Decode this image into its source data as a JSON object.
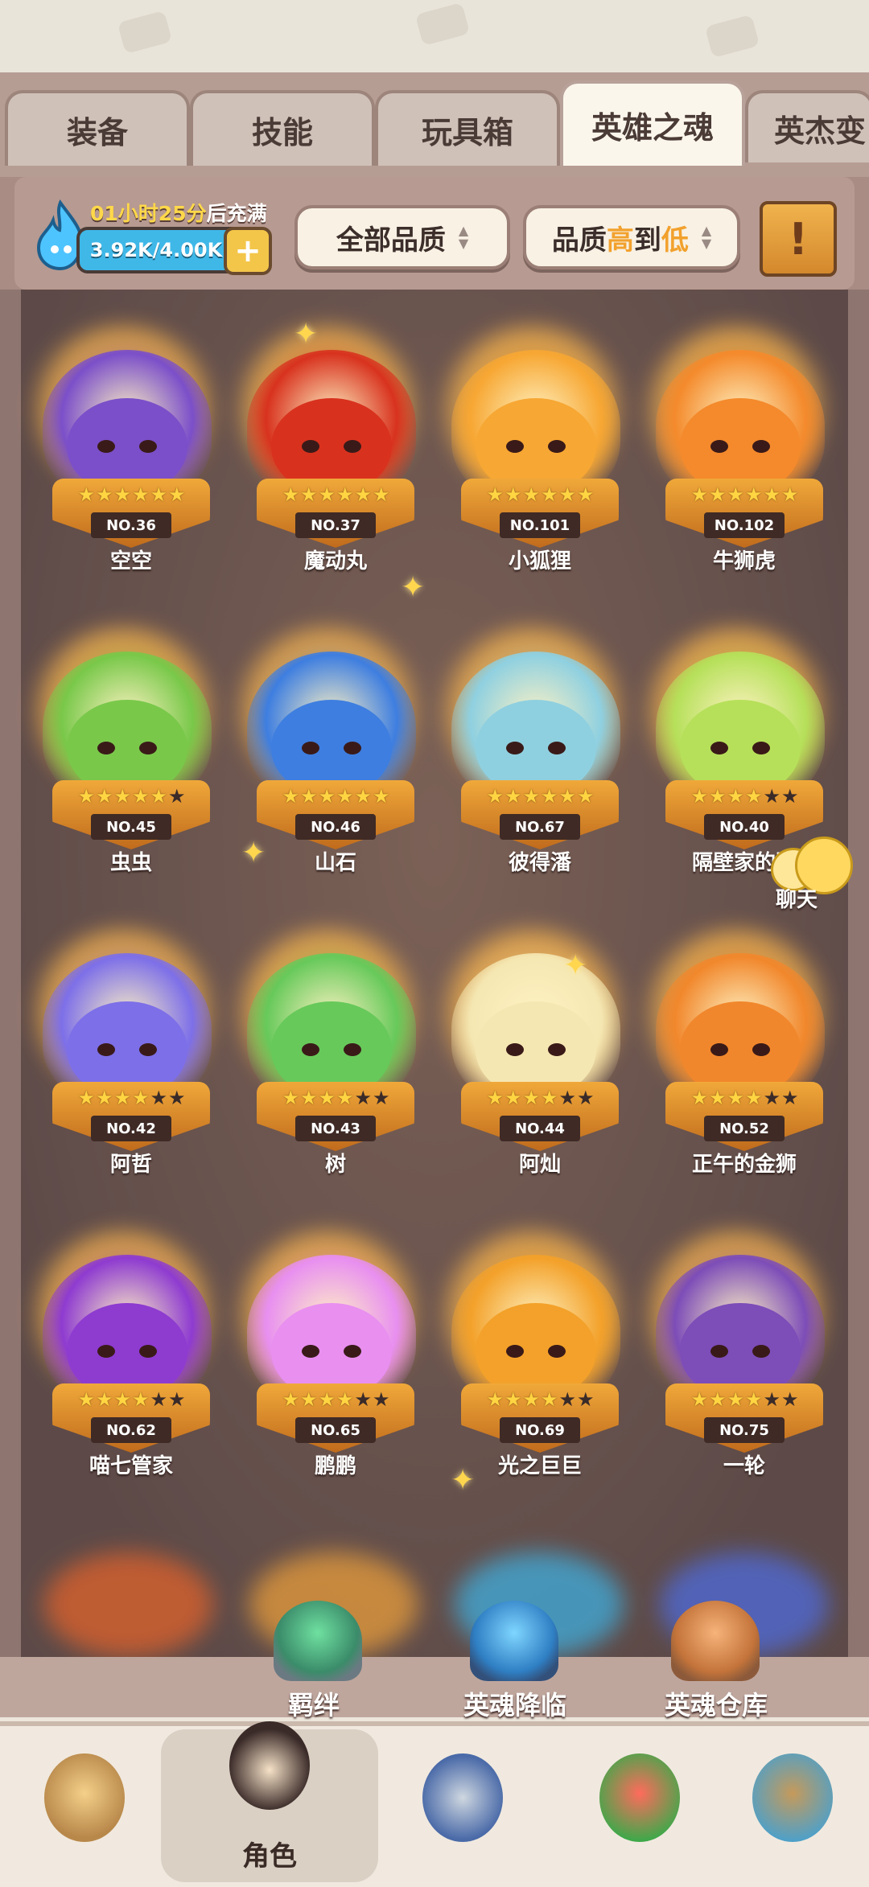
{
  "tabs": [
    "装备",
    "技能",
    "玩具箱",
    "英雄之魂",
    "英杰变"
  ],
  "active_tab": 3,
  "resource": {
    "timer_hours": "01小时",
    "timer_minutes": "25分",
    "timer_suffix": "后充满",
    "value": "3.92K/4.00K",
    "plus": "+"
  },
  "filters": {
    "quality": "全部品质",
    "sort_prefix": "品质",
    "sort_high": "高",
    "sort_mid": "到",
    "sort_low": "低"
  },
  "notice_icon": "!",
  "heroes": [
    {
      "no": "NO.36",
      "name": "空空",
      "stars": 6,
      "color": "#7b4fc9"
    },
    {
      "no": "NO.37",
      "name": "魔动丸",
      "stars": 6,
      "color": "#d8321e"
    },
    {
      "no": "NO.101",
      "name": "小狐狸",
      "stars": 6,
      "color": "#f7a733"
    },
    {
      "no": "NO.102",
      "name": "牛狮虎",
      "stars": 6,
      "color": "#f48a2c"
    },
    {
      "no": "NO.45",
      "name": "虫虫",
      "stars": 5,
      "color": "#79c84a"
    },
    {
      "no": "NO.46",
      "name": "山石",
      "stars": 6,
      "color": "#3e7ee0"
    },
    {
      "no": "NO.67",
      "name": "彼得潘",
      "stars": 6,
      "color": "#8fd0e0"
    },
    {
      "no": "NO.40",
      "name": "隔壁家的阿",
      "stars": 4,
      "color": "#b6e05a"
    },
    {
      "no": "NO.42",
      "name": "阿哲",
      "stars": 4,
      "color": "#7d6fe8"
    },
    {
      "no": "NO.43",
      "name": "树",
      "stars": 4,
      "color": "#67c95a"
    },
    {
      "no": "NO.44",
      "name": "阿灿",
      "stars": 4,
      "color": "#f5e7b2"
    },
    {
      "no": "NO.52",
      "name": "正午的金狮",
      "stars": 4,
      "color": "#f1872c"
    },
    {
      "no": "NO.62",
      "name": "喵七管家",
      "stars": 4,
      "color": "#8e3bd0"
    },
    {
      "no": "NO.65",
      "name": "鹏鹏",
      "stars": 4,
      "color": "#e88ff0"
    },
    {
      "no": "NO.69",
      "name": "光之巨巨",
      "stars": 4,
      "color": "#f3a12a"
    },
    {
      "no": "NO.75",
      "name": "一轮",
      "stars": 4,
      "color": "#7d4db8"
    }
  ],
  "chat_label": "聊天",
  "func_buttons": [
    "羁绊",
    "英魂降临",
    "英魂仓库"
  ],
  "nav": {
    "active_label": "角色",
    "icons": [
      "barbarian-icon",
      "character-icon",
      "sword-shield-icon",
      "dragon-pet-icon",
      "totem-icon"
    ]
  },
  "colors": {
    "tab_active": "#fbf6ec",
    "pedestal": "#f0a83a",
    "soul_bar": "#3fb8e8"
  }
}
